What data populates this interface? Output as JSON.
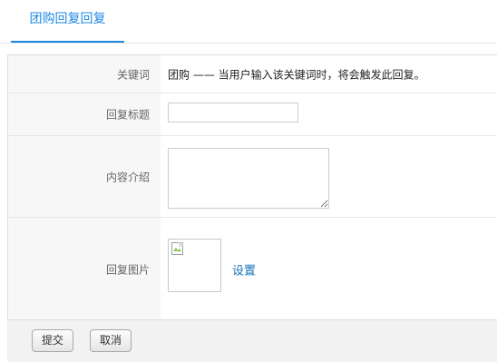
{
  "tabs": {
    "active_label": "团购回复回复"
  },
  "form": {
    "keyword": {
      "label": "关键词",
      "value": "团购 —— 当用户输入该关键词时，将会触发此回复。"
    },
    "title": {
      "label": "回复标题",
      "value": ""
    },
    "content": {
      "label": "内容介绍",
      "value": ""
    },
    "image": {
      "label": "回复图片",
      "set_link": "设置",
      "icon": "broken-image-icon"
    }
  },
  "footer": {
    "submit_label": "提交",
    "cancel_label": "取消"
  },
  "colors": {
    "accent": "#1e88e5",
    "link": "#1a73b8",
    "label_bg": "#f7f7f7",
    "footer_bg": "#f2f2f2"
  }
}
